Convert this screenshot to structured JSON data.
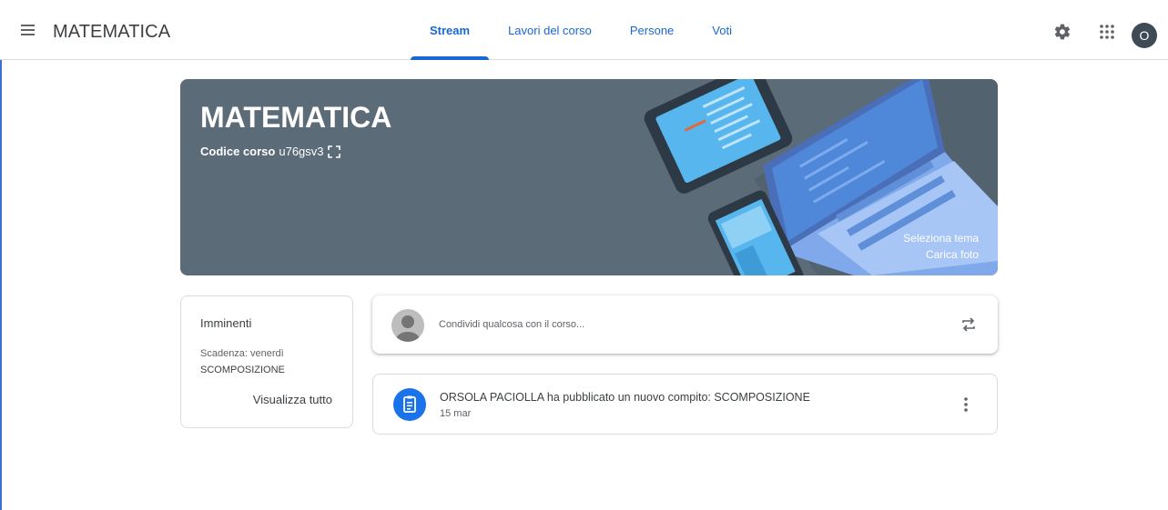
{
  "header": {
    "title": "MATEMATICA",
    "tabs": [
      {
        "label": "Stream",
        "active": true
      },
      {
        "label": "Lavori del corso",
        "active": false
      },
      {
        "label": "Persone",
        "active": false
      },
      {
        "label": "Voti",
        "active": false
      }
    ],
    "icons": [
      "menu-icon",
      "settings-icon",
      "apps-icon"
    ],
    "account_initial": "O"
  },
  "banner": {
    "title": "MATEMATICA",
    "code_label": "Codice corso",
    "code_value": "u76gsv3",
    "select_theme": "Seleziona tema",
    "upload_photo": "Carica foto",
    "bg_color": "#5b6b78"
  },
  "upcoming": {
    "title": "Imminenti",
    "due": "Scadenza: venerdì",
    "item": "SCOMPOSIZIONE",
    "view_all": "Visualizza tutto"
  },
  "share": {
    "placeholder": "Condividi qualcosa con il corso..."
  },
  "post": {
    "title": "ORSOLA PACIOLLA ha pubblicato un nuovo compito: SCOMPOSIZIONE",
    "date": "15 mar",
    "icon": "assignment-icon"
  },
  "colors": {
    "accent": "#1967d2",
    "assignment": "#1a73e8"
  }
}
